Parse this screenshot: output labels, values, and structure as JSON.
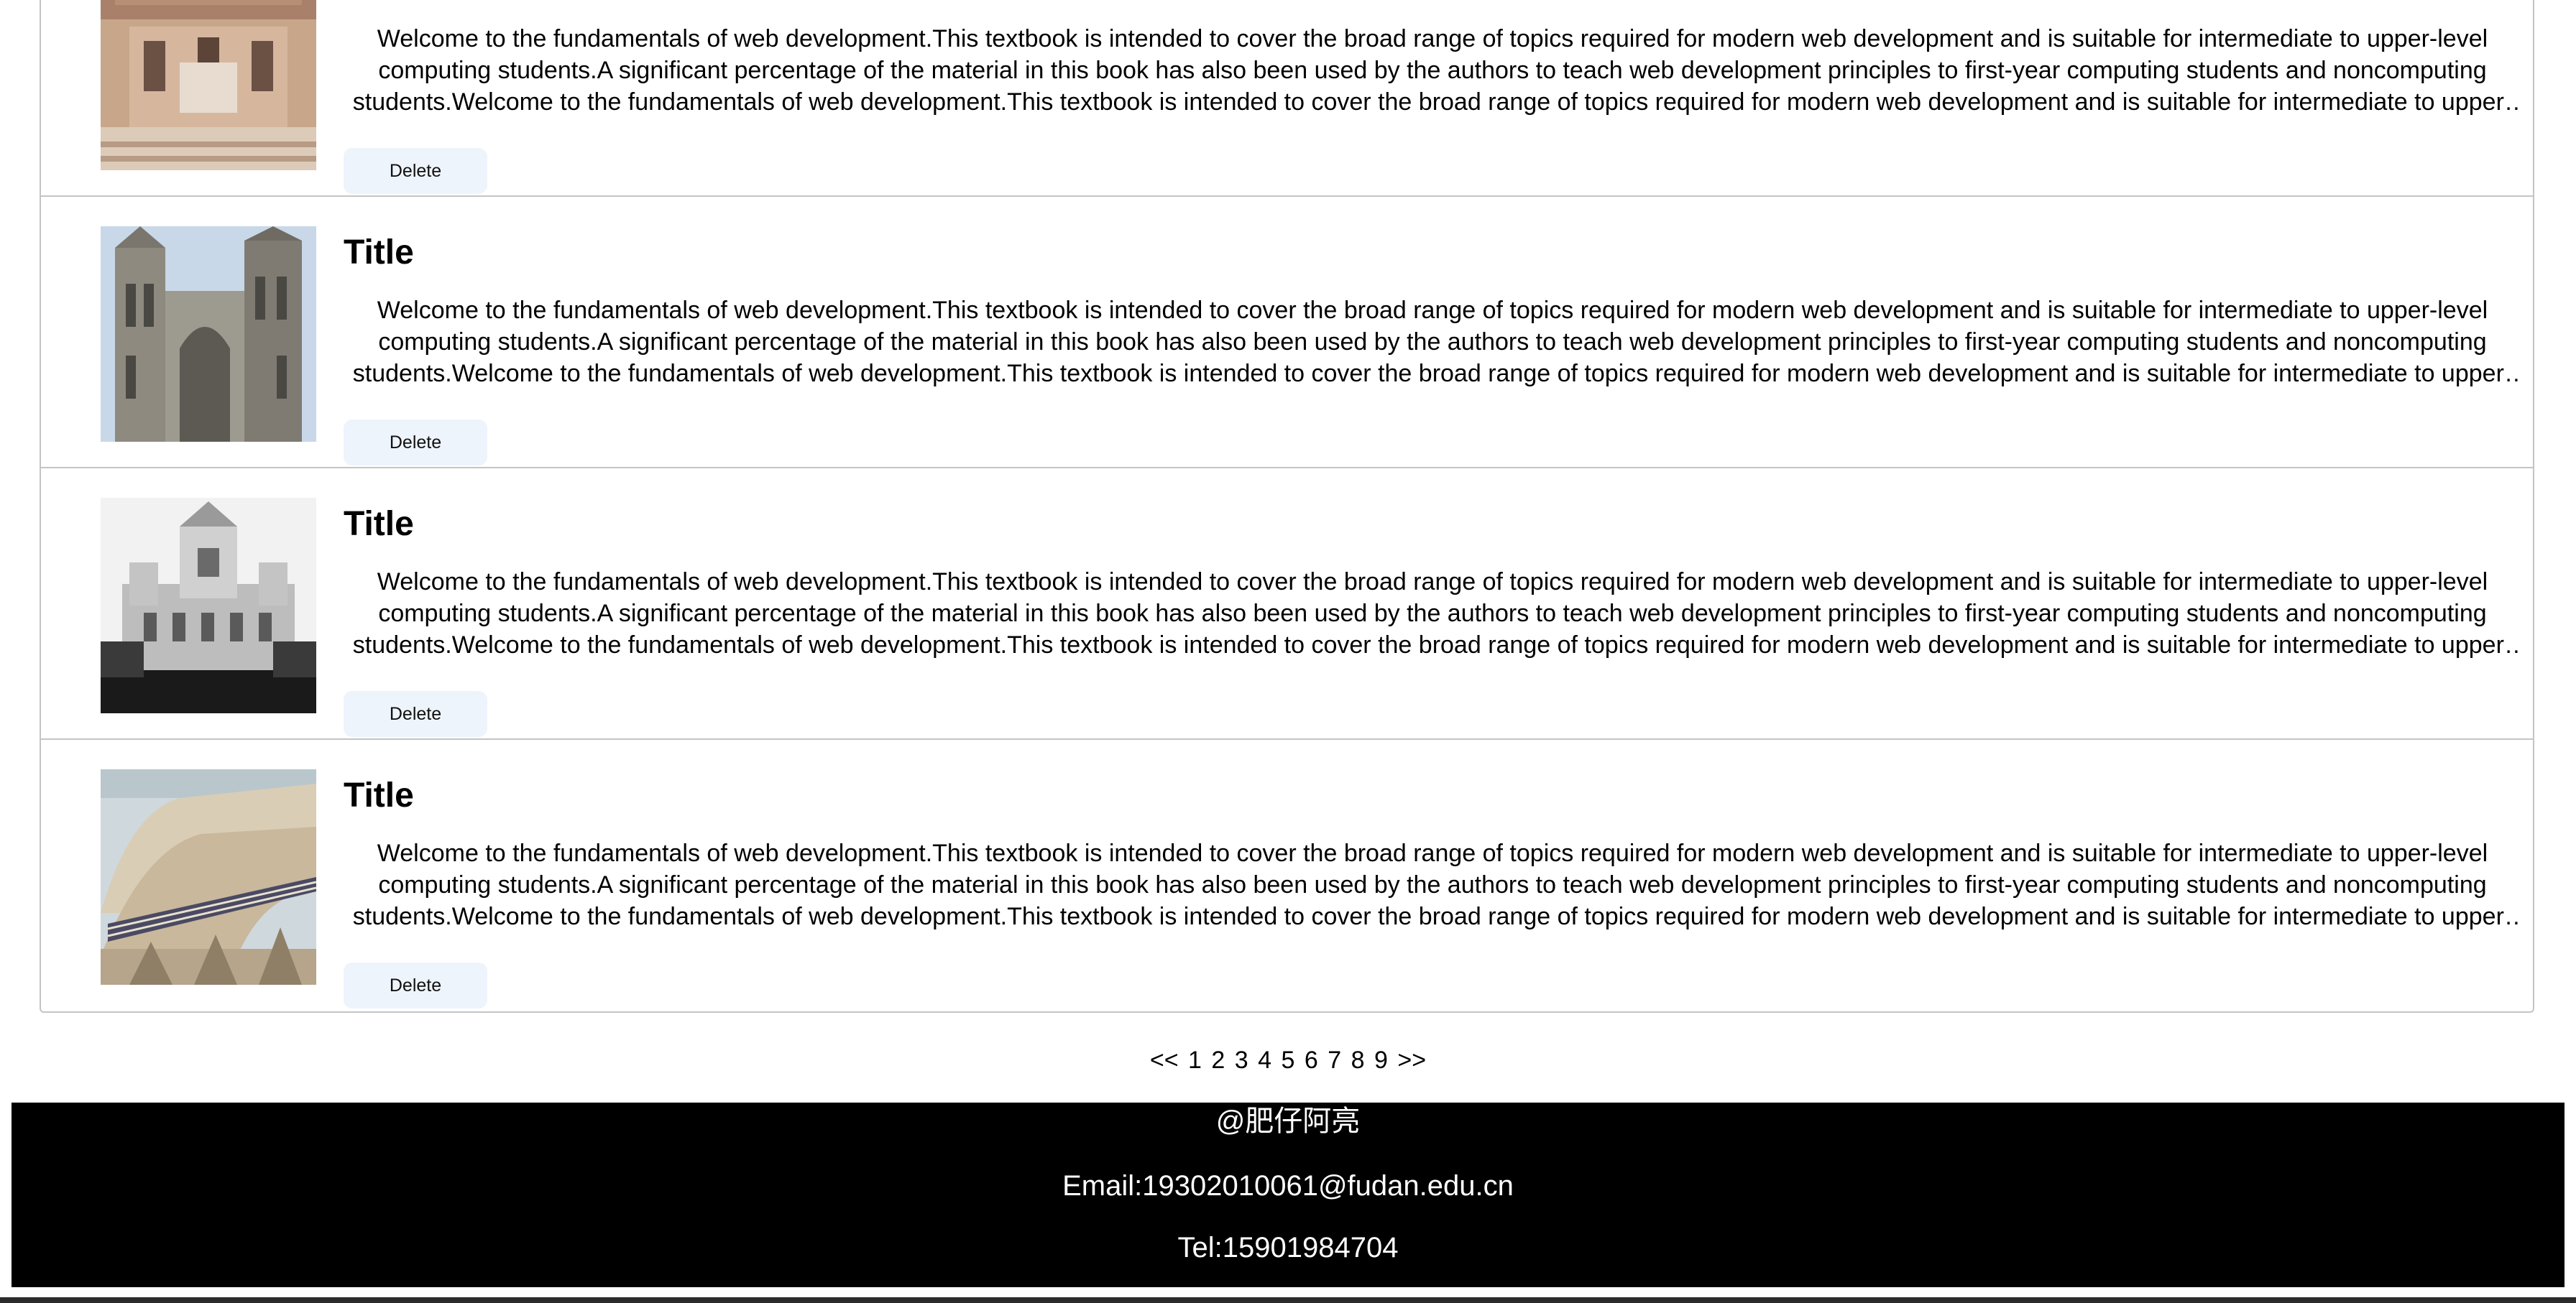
{
  "items": [
    {
      "title": "",
      "description": "Welcome to the fundamentals of web development.This textbook is intended to cover the broad range of topics required for modern web development and is suitable for intermediate to upper-level computing students.A significant percentage of the material in this book has also been used by the authors to teach web development principles to first-year computing students and noncomputing students.Welcome to the fundamentals of web development.This textbook is intended to cover the broad range of topics required for modern web development and is suitable for intermediate to upper-level computing students.",
      "delete_label": "Delete",
      "image_icon": "building-facade-photo"
    },
    {
      "title": "Title",
      "description": "Welcome to the fundamentals of web development.This textbook is intended to cover the broad range of topics required for modern web development and is suitable for intermediate to upper-level computing students.A significant percentage of the material in this book has also been used by the authors to teach web development principles to first-year computing students and noncomputing students.Welcome to the fundamentals of web development.This textbook is intended to cover the broad range of topics required for modern web development and is suitable for intermediate to upper-level computing students.",
      "delete_label": "Delete",
      "image_icon": "gothic-abbey-photo"
    },
    {
      "title": "Title",
      "description": "Welcome to the fundamentals of web development.This textbook is intended to cover the broad range of topics required for modern web development and is suitable for intermediate to upper-level computing students.A significant percentage of the material in this book has also been used by the authors to teach web development principles to first-year computing students and noncomputing students.Welcome to the fundamentals of web development.This textbook is intended to cover the broad range of topics required for modern web development and is suitable for intermediate to upper-level computing students.",
      "delete_label": "Delete",
      "image_icon": "palace-bw-photo"
    },
    {
      "title": "Title",
      "description": "Welcome to the fundamentals of web development.This textbook is intended to cover the broad range of topics required for modern web development and is suitable for intermediate to upper-level computing students.A significant percentage of the material in this book has also been used by the authors to teach web development principles to first-year computing students and noncomputing students.Welcome to the fundamentals of web development.This textbook is intended to cover the broad range of topics required for modern web development and is suitable for intermediate to upper-level computing students.",
      "delete_label": "Delete",
      "image_icon": "arched-roof-photo"
    }
  ],
  "pagination": {
    "prev": "<<",
    "pages": [
      "1",
      "2",
      "3",
      "4",
      "5",
      "6",
      "7",
      "8",
      "9"
    ],
    "next": ">>"
  },
  "footer": {
    "author": "@肥仔阿亮",
    "email": "Email:19302010061@fudan.edu.cn",
    "tel": "Tel:15901984704"
  },
  "colors": {
    "footer_bg": "#000000",
    "button_bg": "#eef4fc",
    "border": "#c4c4c4"
  }
}
